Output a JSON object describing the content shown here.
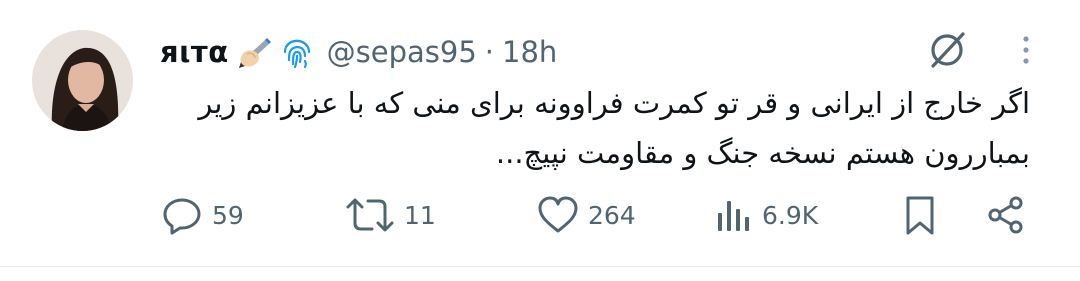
{
  "tweet": {
    "display_name": "яιтα",
    "handle": "@sepas95",
    "separator": "·",
    "time": "18h",
    "text_line1": "اگر خارج از ایرانی و قر تو کمرت فراوونه برای منی که با عزیزانم زیر",
    "text_line2": "بمباررون هستم نسخه جنگ و مقاومت نپیچ...",
    "name_emoji_icons": [
      "writing-hand-icon",
      "fingerprint-icon"
    ]
  },
  "actions": {
    "replies": "59",
    "reposts": "11",
    "likes": "264",
    "views": "6.9K"
  },
  "colors": {
    "text": "#0f1419",
    "secondary": "#536471",
    "fingerprint": "#1d9bf0",
    "divider": "#e6e9eb"
  }
}
